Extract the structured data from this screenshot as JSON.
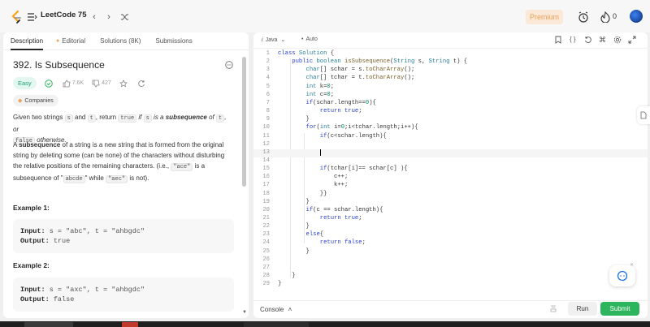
{
  "topbar": {
    "problem_list_title": "LeetCode 75",
    "premium_label": "Premium",
    "streak_count": "0"
  },
  "tabs": [
    {
      "label": "Description",
      "active": true
    },
    {
      "label": "Editorial",
      "active": false
    },
    {
      "label": "Solutions (8K)",
      "active": false
    },
    {
      "label": "Submissions",
      "active": false
    }
  ],
  "problem": {
    "title": "392. Is Subsequence",
    "difficulty": "Easy",
    "likes": "7.6K",
    "dislikes": "427",
    "companies_label": "Companies",
    "desc1": {
      "p1": "Given two strings ",
      "c1": "s",
      "p2": " and ",
      "c2": "t",
      "p3": ", return ",
      "c3": "true",
      "p4": " if ",
      "c4": "s",
      "p5": " is a ",
      "p6": "subsequence",
      "p7": " of ",
      "c5": "t",
      "p8": ", or",
      "c6": "false",
      "p9": " otherwise."
    },
    "desc2": {
      "p1": "A ",
      "p2": "subsequence",
      "p3": " of a string is a new string that is formed from the original string by deleting some (can be none) of the characters without disturbing the relative positions of the remaining characters. (i.e., ",
      "c1": "\"ace\"",
      "p4": " is a subsequence of \"",
      "c2": "abcde",
      "p5": "\" while ",
      "c3": "\"aec\"",
      "p6": " is not)."
    },
    "examples": [
      {
        "title": "Example 1:",
        "input_label": "Input:",
        "input": "s = \"abc\", t = \"ahbgdc\"",
        "output_label": "Output:",
        "output": "true"
      },
      {
        "title": "Example 2:",
        "input_label": "Input:",
        "input": "s = \"axc\", t = \"ahbgdc\"",
        "output_label": "Output:",
        "output": "false"
      }
    ]
  },
  "editor": {
    "language": "Java",
    "autosave": "Auto",
    "lines": [
      "class Solution {",
      "    public boolean isSubsequence(String s, String t) {",
      "        char[] schar = s.toCharArray();",
      "        char[] tchar = t.toCharArray();",
      "        int k=0;",
      "        int c=0;",
      "        if(schar.length==0){",
      "            return true;",
      "        }",
      "        for(int i=0;i<tchar.length;i++){",
      "            if(c<schar.length){",
      "",
      "            ",
      "",
      "            if(tchar[i]== schar[c] ){",
      "                c++;",
      "                k++;",
      "            }}",
      "        }",
      "        if(c == schar.length){",
      "            return true;",
      "        }",
      "        else{",
      "            return false;",
      "        }",
      "",
      "",
      "    }",
      "}"
    ]
  },
  "console": {
    "label": "Console",
    "run_label": "Run",
    "submit_label": "Submit"
  },
  "colors": {
    "accent_green": "#2db55d",
    "easy_teal": "#1aa37a",
    "premium_orange": "#e9a25c",
    "keyword_blue": "#2a3fd1"
  }
}
